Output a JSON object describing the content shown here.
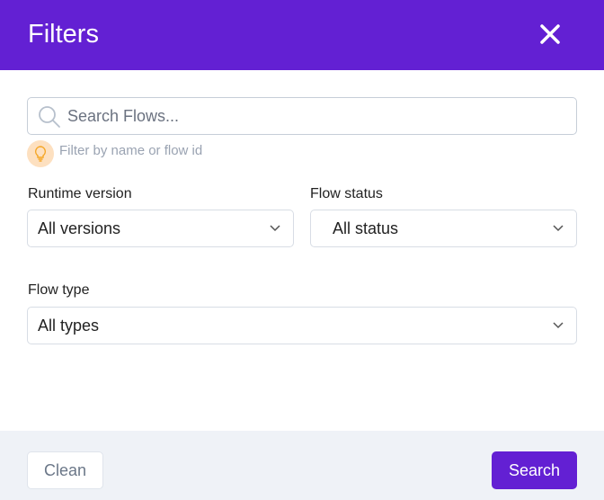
{
  "header": {
    "title": "Filters",
    "close_icon": "close-icon"
  },
  "search": {
    "placeholder": "Search Flows...",
    "value": "",
    "hint": "Filter by name or flow id"
  },
  "filters": {
    "runtime": {
      "label": "Runtime version",
      "value": "All versions"
    },
    "status": {
      "label": "Flow status",
      "value": "All status"
    },
    "type": {
      "label": "Flow type",
      "value": "All types"
    }
  },
  "footer": {
    "clean_label": "Clean",
    "search_label": "Search"
  },
  "colors": {
    "accent": "#6320d3",
    "footer_bg": "#eff2f7",
    "hint_bg": "#fde0c0",
    "hint_icon": "#f5a623"
  }
}
